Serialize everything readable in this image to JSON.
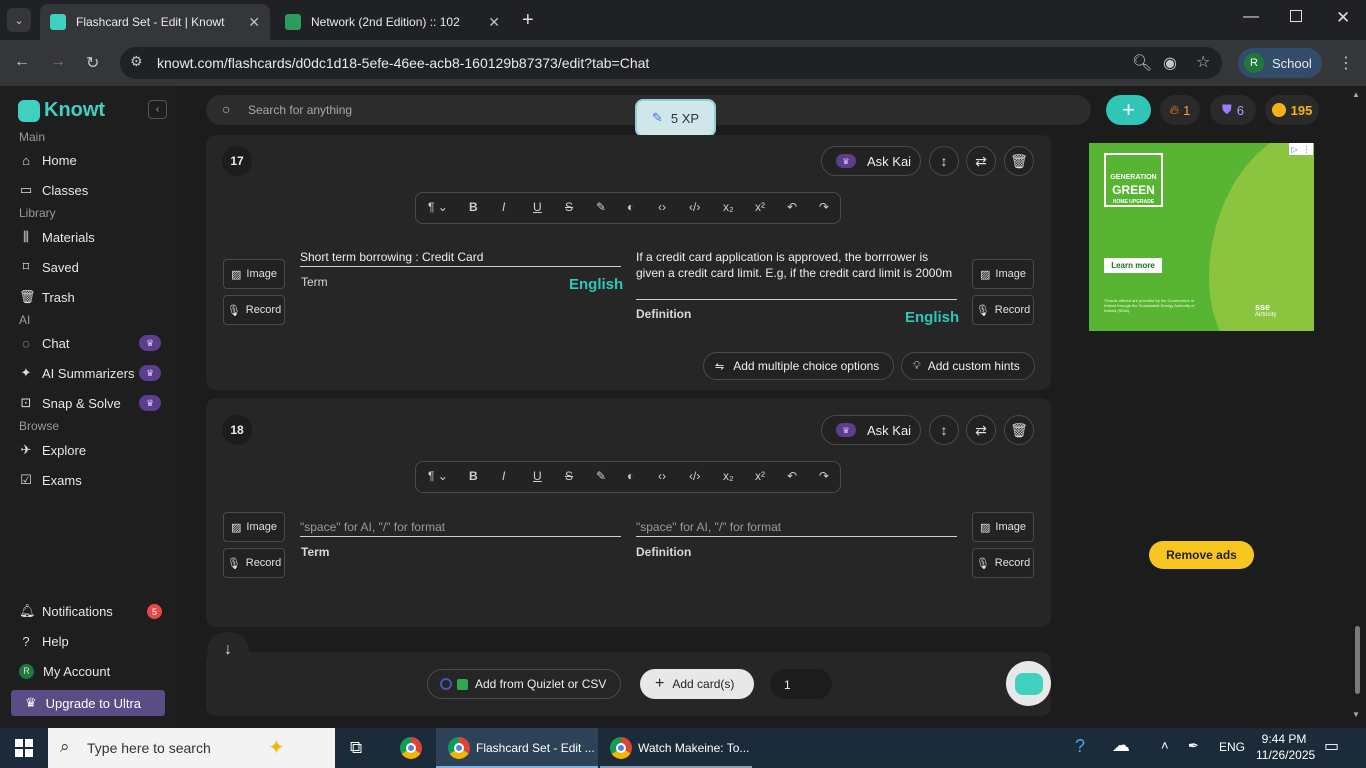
{
  "browser": {
    "tabs": [
      {
        "title": "Flashcard Set - Edit | Knowt",
        "active": true
      },
      {
        "title": "Network (2nd Edition) :: 102",
        "active": false
      }
    ],
    "url": "knowt.com/flashcards/d0dc1d18-5efe-46ee-acb8-160129b87373/edit?tab=Chat",
    "profile": {
      "initial": "R",
      "label": "School"
    }
  },
  "sidebar": {
    "brand": "Knowt",
    "sections": {
      "main": "Main",
      "library": "Library",
      "ai": "AI",
      "browse": "Browse"
    },
    "main_items": [
      {
        "label": "Home"
      },
      {
        "label": "Classes"
      }
    ],
    "library_items": [
      {
        "label": "Materials"
      },
      {
        "label": "Saved"
      },
      {
        "label": "Trash"
      }
    ],
    "ai_items": [
      {
        "label": "Chat"
      },
      {
        "label": "AI Summarizers"
      },
      {
        "label": "Snap & Solve"
      }
    ],
    "browse_items": [
      {
        "label": "Explore"
      },
      {
        "label": "Exams"
      }
    ],
    "bottom_items": [
      {
        "label": "Notifications",
        "badge": "5"
      },
      {
        "label": "Help"
      },
      {
        "label": "My Account",
        "initial": "R"
      }
    ],
    "upgrade": "Upgrade to Ultra"
  },
  "header": {
    "search_placeholder": "Search for anything",
    "xp": "5 XP",
    "streak": "1",
    "gems": "6",
    "coins": "195"
  },
  "cards": [
    {
      "number": "17",
      "ask_kai": "Ask Kai",
      "term": "Short term borrowing : Credit Card",
      "term_label": "Term",
      "term_lang": "English",
      "definition": "If a credit card application is approved, the borrrower is given a credit card limit. E.g, if the credit card limit is 2000m",
      "definition_label": "Definition",
      "definition_lang": "English",
      "image_label": "Image",
      "record_label": "Record",
      "add_mc": "Add multiple choice options",
      "add_hints": "Add custom hints"
    },
    {
      "number": "18",
      "ask_kai": "Ask Kai",
      "term_placeholder": "\"space\" for AI, \"/\" for format",
      "term_label": "Term",
      "definition_placeholder": "\"space\" for AI, \"/\" for format",
      "definition_label": "Definition",
      "image_label": "Image",
      "record_label": "Record"
    }
  ],
  "bottom": {
    "quizlet": "Add from Quizlet or CSV",
    "add_cards": "Add card(s)",
    "count": "1"
  },
  "ad": {
    "logo_line1": "GENERATION",
    "logo_line2": "GREEN",
    "logo_line3": "HOME UPGRADE",
    "learn_more": "Learn more",
    "fine_print": "*Grants offered are provided by the Government of Ireland through the Sustainable Energy Authority of Ireland (SEAI).",
    "brand": "sse",
    "brand_sub": "Airtricity",
    "remove_ads": "Remove ads"
  },
  "taskbar": {
    "search_placeholder": "Type here to search",
    "apps": [
      {
        "title": "Flashcard Set - Edit ...",
        "active": true
      },
      {
        "title": "Watch Makeine: To...",
        "active": false
      }
    ],
    "lang": "ENG",
    "time": "9:44 PM",
    "date": "11/26/2025"
  }
}
